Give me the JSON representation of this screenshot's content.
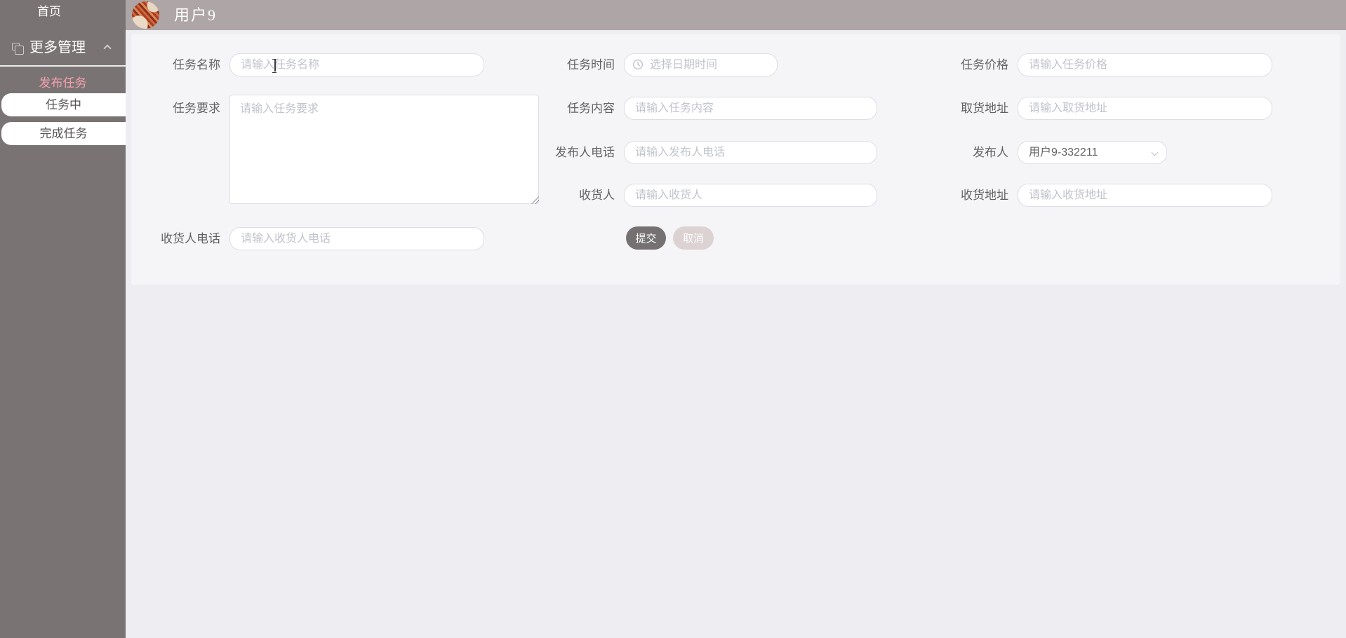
{
  "sidebar": {
    "items": [
      {
        "label": "首页"
      },
      {
        "label": "更多管理"
      },
      {
        "label": "发布任务"
      },
      {
        "label": "任务中"
      },
      {
        "label": "完成任务"
      }
    ]
  },
  "header": {
    "username": "用户9"
  },
  "form": {
    "fields": {
      "task_name": {
        "label": "任务名称",
        "value": "",
        "placeholder": "请输入任务名称"
      },
      "task_time": {
        "label": "任务时间",
        "value": "",
        "placeholder": "选择日期时间"
      },
      "task_price": {
        "label": "任务价格",
        "value": "",
        "placeholder": "请输入任务价格"
      },
      "task_requirement": {
        "label": "任务要求",
        "value": "",
        "placeholder": "请输入任务要求"
      },
      "task_content": {
        "label": "任务内容",
        "value": "",
        "placeholder": "请输入任务内容"
      },
      "pickup_address": {
        "label": "取货地址",
        "value": "",
        "placeholder": "请输入取货地址"
      },
      "publisher_phone": {
        "label": "发布人电话",
        "value": "",
        "placeholder": "请输入发布人电话"
      },
      "publisher": {
        "label": "发布人",
        "value": "用户9-332211"
      },
      "consignee": {
        "label": "收货人",
        "value": "",
        "placeholder": "请输入收货人"
      },
      "delivery_address": {
        "label": "收货地址",
        "value": "",
        "placeholder": "请输入收货地址"
      },
      "consignee_phone": {
        "label": "收货人电话",
        "value": "",
        "placeholder": "请输入收货人电话"
      }
    },
    "buttons": {
      "submit": "提交",
      "cancel": "取消"
    }
  },
  "icons": {
    "more_management": "copy-icon",
    "more_management_state": "chevron-up-icon",
    "date_picker": "clock-icon",
    "publisher_select": "chevron-down-icon"
  },
  "colors": {
    "sidebar_bg": "#7a7374",
    "header_bg": "#ada5a6",
    "page_bg": "#eeedf1",
    "card_bg": "#f5f4f6",
    "active_menu_text": "#f1a0ab",
    "submit_button_bg": "#757071",
    "cancel_button_bg": "#dcd2d2",
    "input_border": "#dcdfe6",
    "placeholder_text": "#c0c4cc"
  }
}
